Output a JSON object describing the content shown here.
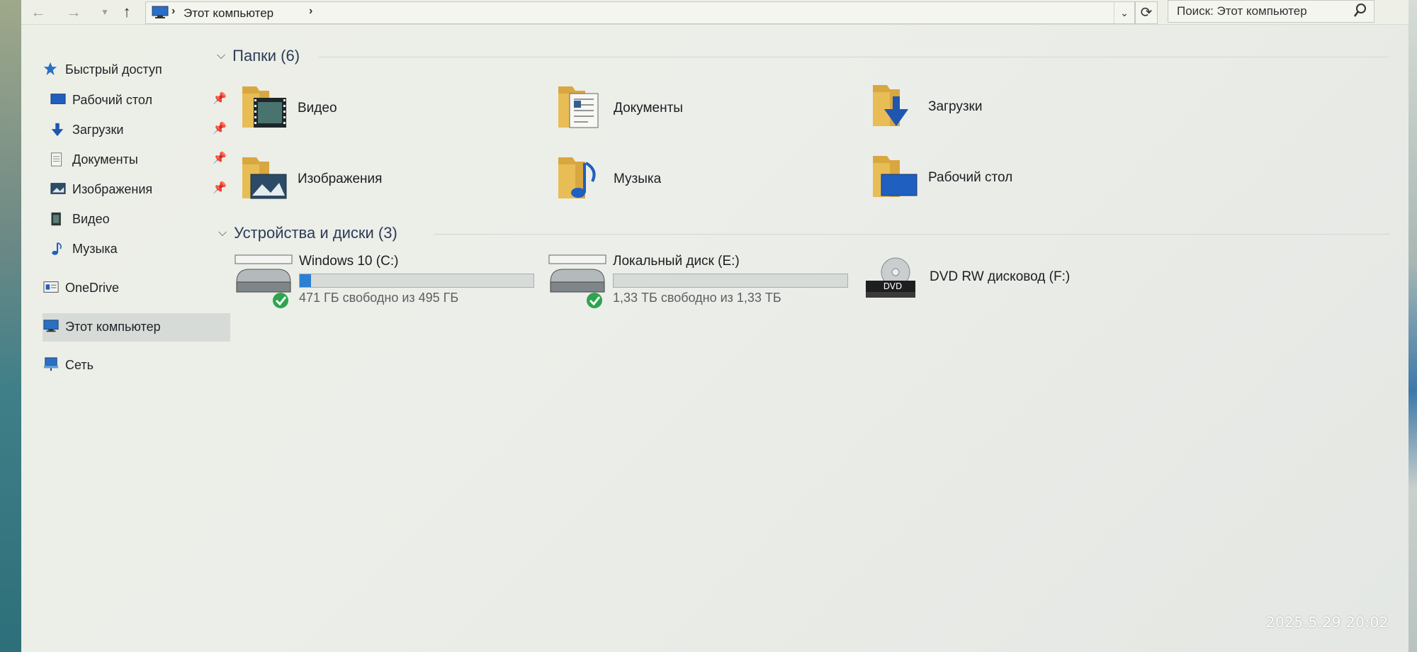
{
  "address_bar": {
    "breadcrumb": "Этот компьютер",
    "search_placeholder": "Поиск: Этот компьютер"
  },
  "sidebar": {
    "items": [
      {
        "label": "Быстрый доступ",
        "icon": "star-icon",
        "pinned": false
      },
      {
        "label": "Рабочий стол",
        "icon": "desktop-icon",
        "pinned": true
      },
      {
        "label": "Загрузки",
        "icon": "download-icon",
        "pinned": true
      },
      {
        "label": "Документы",
        "icon": "document-icon",
        "pinned": true
      },
      {
        "label": "Изображения",
        "icon": "image-icon",
        "pinned": true
      },
      {
        "label": "Видео",
        "icon": "video-icon",
        "pinned": false
      },
      {
        "label": "Музыка",
        "icon": "music-icon",
        "pinned": false
      },
      {
        "label": "OneDrive",
        "icon": "onedrive-icon",
        "pinned": false
      },
      {
        "label": "Этот компьютер",
        "icon": "computer-icon",
        "pinned": false,
        "selected": true
      },
      {
        "label": "Сеть",
        "icon": "network-icon",
        "pinned": false
      }
    ]
  },
  "main": {
    "folders_header": "Папки (6)",
    "folders": [
      {
        "label": "Видео",
        "icon": "video-folder-icon"
      },
      {
        "label": "Документы",
        "icon": "documents-folder-icon"
      },
      {
        "label": "Загрузки",
        "icon": "downloads-folder-icon"
      },
      {
        "label": "Изображения",
        "icon": "pictures-folder-icon"
      },
      {
        "label": "Музыка",
        "icon": "music-folder-icon"
      },
      {
        "label": "Рабочий стол",
        "icon": "desktop-folder-icon"
      }
    ],
    "devices_header": "Устройства и диски (3)",
    "drives": [
      {
        "name": "Windows 10 (C:)",
        "free_text": "471 ГБ свободно из 495 ГБ",
        "used_fraction": 0.048,
        "icon": "hard-drive-icon"
      },
      {
        "name": "Локальный диск (E:)",
        "free_text": "1,33 ТБ свободно из 1,33 ТБ",
        "used_fraction": 0.0,
        "icon": "hard-drive-icon"
      },
      {
        "name": "DVD RW дисковод (F:)",
        "icon": "dvd-drive-icon",
        "icon_text": "DVD"
      }
    ]
  },
  "timestamp": "2025.5.29 20:02",
  "colors": {
    "accent": "#2b7fd4",
    "folder": "#e2b54a"
  }
}
